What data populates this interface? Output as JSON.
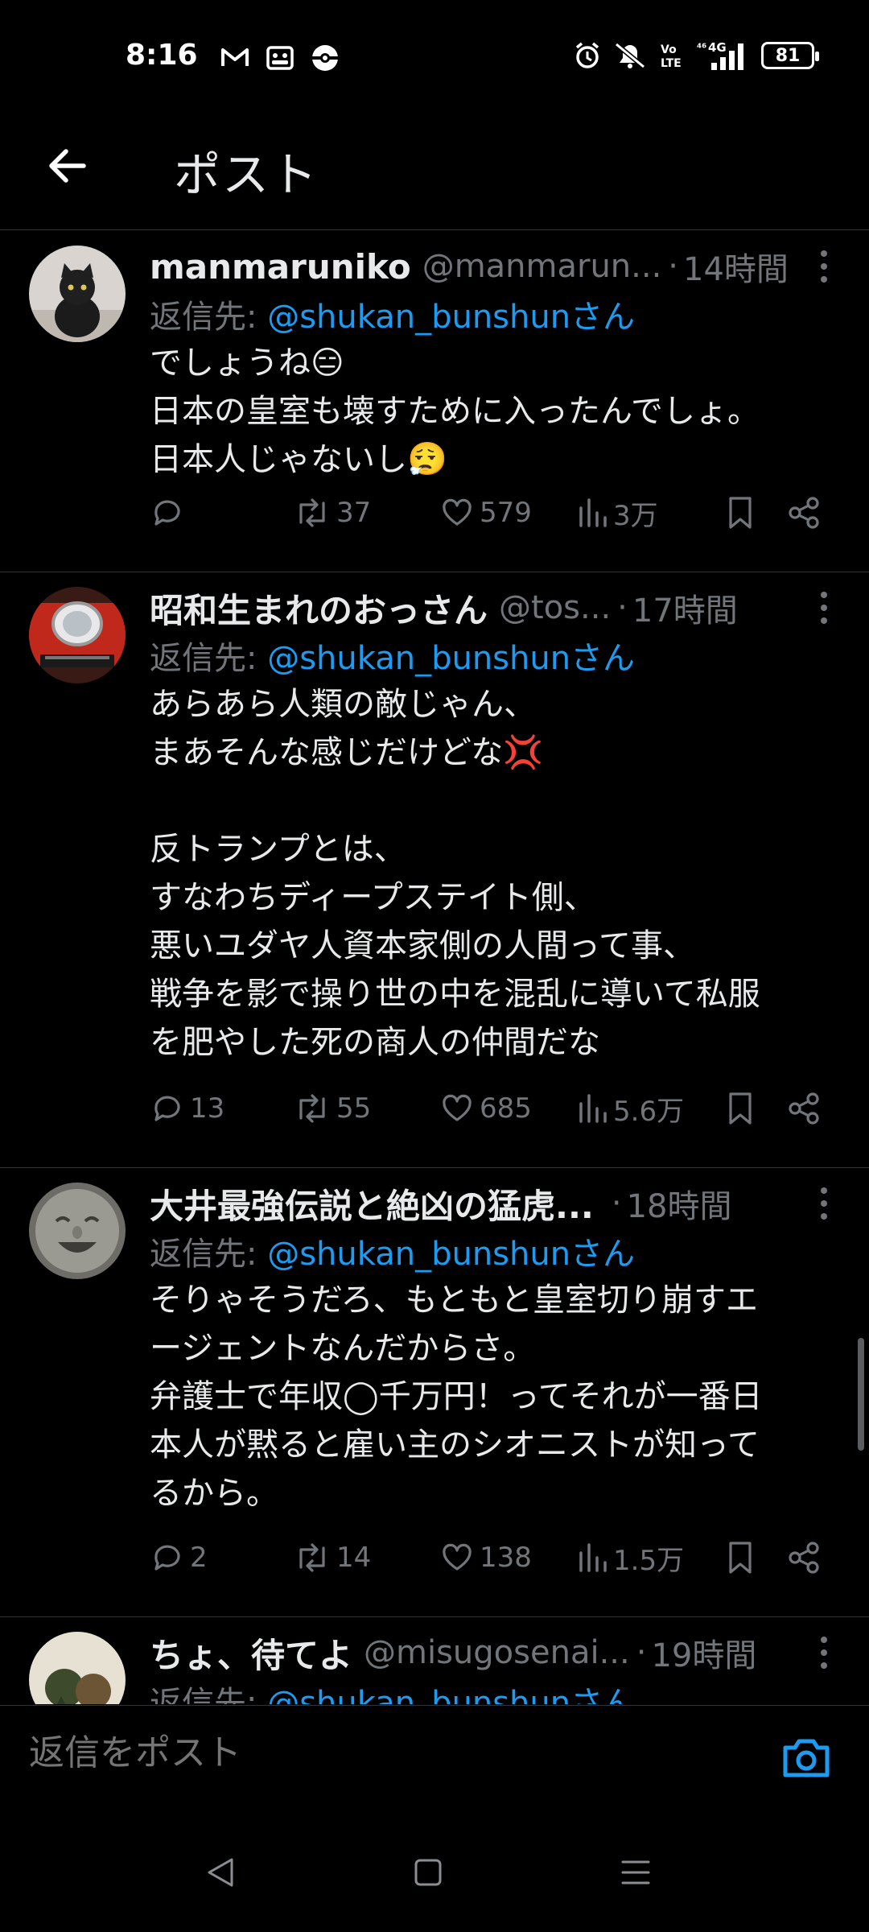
{
  "status_bar": {
    "time": "8:16",
    "battery": "81",
    "network": "4G",
    "left_icons": [
      "gmail-icon",
      "teams-icon",
      "pokeball-icon"
    ],
    "right_icons": [
      "alarm-icon",
      "mute-icon",
      "volte-icon",
      "signal-icon",
      "battery-icon"
    ]
  },
  "header": {
    "title": "ポスト",
    "back_icon": "arrow-left-icon"
  },
  "colors": {
    "accent": "#1d9bf0",
    "muted": "#71767b",
    "text": "#e7e9ea",
    "background": "#000000"
  },
  "posts": [
    {
      "name": "manmaruniko",
      "handle": "@manmarun...",
      "time": "14時間",
      "reply_label": "返信先: ",
      "reply_mention": "@shukan_bunshunさん",
      "body": "でしょうね😑\n日本の皇室も壊すために入ったんでしょ。\n日本人じゃないし😮‍💨",
      "replies": "",
      "reposts": "37",
      "likes": "579",
      "views": "3万"
    },
    {
      "name": "昭和生まれのおっさん",
      "handle": "@tos...",
      "time": "17時間",
      "reply_label": "返信先: ",
      "reply_mention": "@shukan_bunshunさん",
      "body": "あらあら人類の敵じゃん、\nまあそんな感じだけどな💢\n\n反トランプとは、\nすなわちディープステイト側、\n悪いユダヤ人資本家側の人間って事、\n戦争を影で操り世の中を混乱に導いて私服\nを肥やした死の商人の仲間だな",
      "replies": "13",
      "reposts": "55",
      "likes": "685",
      "views": "5.6万"
    },
    {
      "name": "大井最強伝説と絶凶の猛虎...",
      "handle": "",
      "time": "18時間",
      "reply_label": "返信先: ",
      "reply_mention": "@shukan_bunshunさん",
      "body": "そりゃそうだろ、もともと皇室切り崩すエ\nージェントなんだからさ。\n弁護士で年収◯千万円！ってそれが一番日\n本人が黙ると雇い主のシオニストが知って\nるから。",
      "replies": "2",
      "reposts": "14",
      "likes": "138",
      "views": "1.5万"
    },
    {
      "name": "ちょ、待てよ",
      "handle": "@misugosenai...",
      "time": "19時間",
      "reply_label": "返信先: ",
      "reply_mention": "@shukan_bunshunさん",
      "body": "",
      "replies": "",
      "reposts": "",
      "likes": "",
      "views": ""
    }
  ],
  "compose": {
    "placeholder": "返信をポスト",
    "camera_icon": "camera-icon"
  },
  "nav": {
    "icons": [
      "back-triangle-icon",
      "home-square-icon",
      "menu-lines-icon"
    ]
  }
}
